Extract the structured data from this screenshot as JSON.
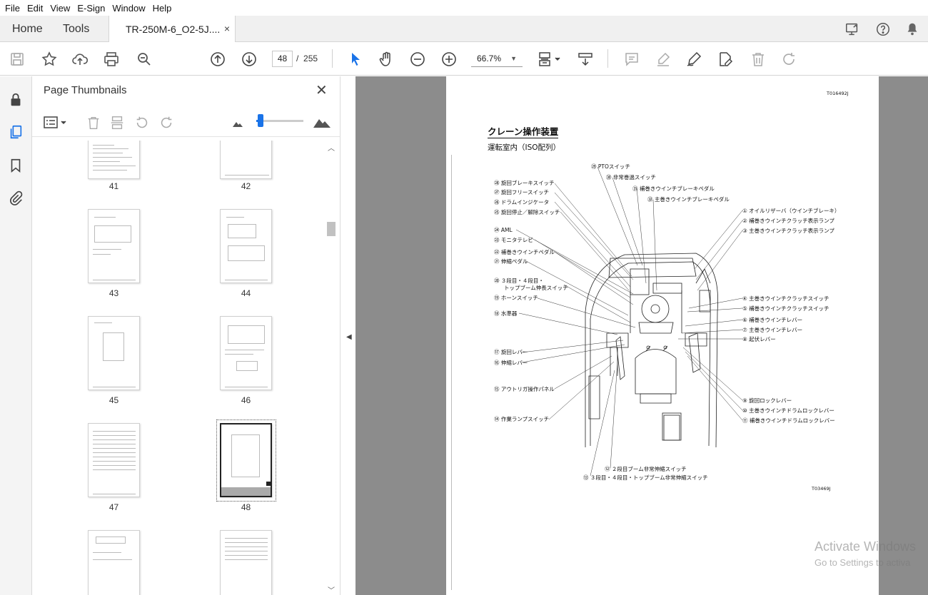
{
  "menu": [
    "File",
    "Edit",
    "View",
    "E-Sign",
    "Window",
    "Help"
  ],
  "tabs": {
    "home": "Home",
    "tools": "Tools",
    "document": "TR-250M-6_O2-5J....",
    "close": "×"
  },
  "toolbar": {
    "page_current": "48",
    "page_separator": "/",
    "page_total": "255",
    "zoom": "66.7%"
  },
  "panel": {
    "title": "Page Thumbnails",
    "close": "✕"
  },
  "thumbnails": [
    "41",
    "42",
    "43",
    "44",
    "45",
    "46",
    "47",
    "48"
  ],
  "document": {
    "ref_top": "T016492J",
    "title": "クレーン操作装置",
    "subtitle": "運転室内（ISO配列）",
    "ref_bottom": "T03469J",
    "callouts_left": [
      "㉘ 旋回ブレーキスイッチ",
      "㉗ 旋回フリースイッチ",
      "㉖ ドラムインジケータ",
      "㉕ 旋回停止／解除スイッチ",
      "㉔ AML",
      "㉓ モニタテレビ",
      "㉒ 補巻きウインチペダル",
      "㉑ 伸縮ペダル",
      "⑳ ３段目・４段目・",
      "トップブーム伸長スイッチ",
      "⑲ ホーンスイッチ",
      "⑱ 水準器",
      "⑰ 旋回レバー",
      "⑯ 伸縮レバー",
      "⑮ アウトリガ操作パネル",
      "⑭ 作業ランプスイッチ"
    ],
    "callouts_top": [
      "㉙ PTOスイッチ",
      "㉚ 非常巻過スイッチ",
      "㉛ 補巻きウインチブレーキペダル",
      "㉜ 主巻きウインチブレーキペダル"
    ],
    "callouts_right": [
      "① オイルリザーバ（ウインチブレーキ）",
      "② 補巻きウインチクラッチ表示ランプ",
      "③ 主巻きウインチクラッチ表示ランプ",
      "④ 主巻きウインチクラッチスイッチ",
      "⑤ 補巻きウインチクラッチスイッチ",
      "⑥ 補巻きウインチレバー",
      "⑦ 主巻きウインチレバー",
      "⑧ 起伏レバー",
      "⑨ 旋回ロックレバー",
      "⑩ 主巻きウインチドラムロックレバー",
      "⑪ 補巻きウインチドラムロックレバー"
    ],
    "callouts_bottom": [
      "⑫ ２段目ブーム非常伸縮スイッチ",
      "⑬ ３段目・４段目・トップブーム非常伸縮スイッチ"
    ]
  },
  "watermark": {
    "line1": "Activate Windows",
    "line2": "Go to Settings to activa"
  }
}
